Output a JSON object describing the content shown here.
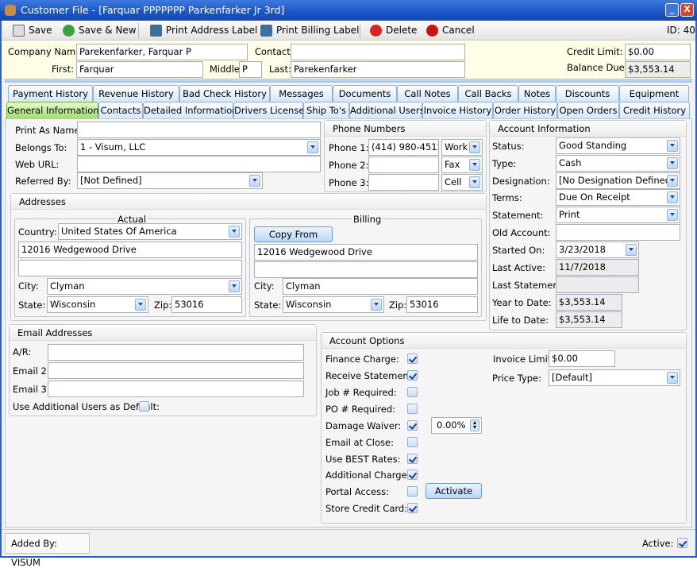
{
  "window": {
    "title": "Customer File - [Farquar PPPPPPP Parkenfarker Jr 3rd]",
    "minimize": "_",
    "close": "X"
  },
  "toolbar": {
    "save": "Save",
    "save_new": "Save & New",
    "print_address": "Print Address Label",
    "print_billing": "Print Billing Label",
    "delete": "Delete",
    "cancel": "Cancel",
    "id": "ID: 40"
  },
  "header": {
    "company_label": "Company Name:",
    "company": "Parekenfarker, Farquar P",
    "contact_label": "Contact:",
    "contact": "",
    "first_label": "First:",
    "first": "Farquar",
    "middle_label": "Middle:",
    "middle": "P",
    "last_label": "Last:",
    "last": "Parekenfarker",
    "credit_label": "Credit Limit:",
    "credit": "$0.00",
    "balance_label": "Balance Due:",
    "balance": "$3,553.14"
  },
  "tabs_row1": [
    "Payment History",
    "Revenue History",
    "Bad Check History",
    "Messages",
    "Documents",
    "Call Notes",
    "Call Backs",
    "Notes",
    "Discounts",
    "Equipment"
  ],
  "tabs_row2": [
    "General Information",
    "Contacts",
    "Detailed Information",
    "Drivers License",
    "Ship To's",
    "Additional Users",
    "Invoice History",
    "Order History",
    "Open Orders",
    "Credit History"
  ],
  "general": {
    "print_as_label": "Print As Name:",
    "print_as": "",
    "belongs_label": "Belongs To:",
    "belongs": "1 - Visum, LLC",
    "web_label": "Web URL:",
    "web": "",
    "referred_label": "Referred By:",
    "referred": "[Not Defined]"
  },
  "phones": {
    "title": "Phone Numbers",
    "items": [
      {
        "label": "Phone 1:",
        "value": "(414) 980-4512",
        "type": "Work"
      },
      {
        "label": "Phone 2:",
        "value": "",
        "type": "Fax"
      },
      {
        "label": "Phone 3:",
        "value": "",
        "type": "Cell"
      }
    ]
  },
  "account_info": {
    "title": "Account Information",
    "status_label": "Status:",
    "status": "Good Standing",
    "type_label": "Type:",
    "type": "Cash",
    "designation_label": "Designation:",
    "designation": "[No Designation Defined]",
    "terms_label": "Terms:",
    "terms": "Due On Receipt",
    "statement_label": "Statement:",
    "statement": "Print",
    "old_label": "Old Account:",
    "old": "",
    "started_label": "Started On:",
    "started": "3/23/2018",
    "last_active_label": "Last Active:",
    "last_active": "11/7/2018",
    "last_statement_label": "Last Statement:",
    "last_statement": "",
    "ytd_label": "Year to Date:",
    "ytd": "$3,553.14",
    "ltd_label": "Life to Date:",
    "ltd": "$3,553.14"
  },
  "addresses": {
    "title": "Addresses",
    "actual": {
      "legend": "Actual",
      "country_label": "Country:",
      "country": "United States Of America",
      "line1": "12016 Wedgewood Drive",
      "line2": "",
      "city_label": "City:",
      "city": "Clyman",
      "state_label": "State:",
      "state": "Wisconsin",
      "zip_label": "Zip:",
      "zip": "53016"
    },
    "billing": {
      "legend": "Billing",
      "copy": "Copy From Actual",
      "line1": "12016 Wedgewood Drive",
      "line2": "",
      "city_label": "City:",
      "city": "Clyman",
      "state_label": "State:",
      "state": "Wisconsin",
      "zip_label": "Zip:",
      "zip": "53016"
    }
  },
  "email": {
    "title": "Email Addresses",
    "ar_label": "A/R:",
    "ar": "",
    "e2_label": "Email 2:",
    "e2": "",
    "e3_label": "Email 3:",
    "e3": "",
    "default_label": "Use Additional Users as Default:",
    "default_checked": false
  },
  "options": {
    "title": "Account Options",
    "items": [
      {
        "label": "Finance Charge:",
        "checked": true
      },
      {
        "label": "Receive Statement:",
        "checked": true
      },
      {
        "label": "Job # Required:",
        "checked": false
      },
      {
        "label": "PO # Required:",
        "checked": false
      },
      {
        "label": "Damage Waiver:",
        "checked": true
      },
      {
        "label": "Email at Close:",
        "checked": false
      },
      {
        "label": "Use BEST Rates:",
        "checked": true
      },
      {
        "label": "Additional Charges:",
        "checked": true
      },
      {
        "label": "Portal Access:",
        "checked": false
      },
      {
        "label": "Store Credit Card:",
        "checked": true
      }
    ],
    "damage_pct": "0.00%",
    "activate": "Activate",
    "invoice_limit_label": "Invoice Limit:",
    "invoice_limit": "$0.00",
    "price_type_label": "Price Type:",
    "price_type": "[Default]"
  },
  "status": {
    "added_by": "Added By: VISUM",
    "active_label": "Active:",
    "active": true
  },
  "colors": {
    "title_bar": "#1a55c6",
    "selected_tab": "#9ede6c",
    "header_bg": "#fffde6"
  }
}
